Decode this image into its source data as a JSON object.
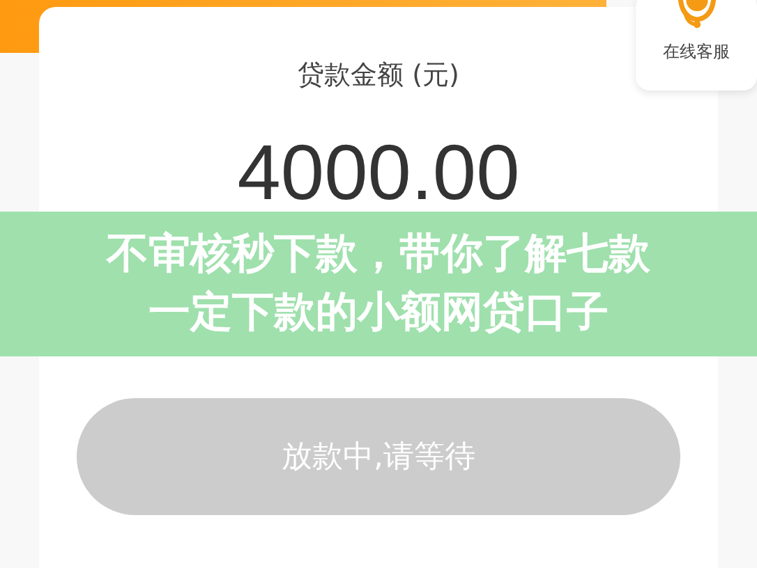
{
  "service": {
    "label": "在线客服"
  },
  "amount": {
    "label": "贷款金额 (元)",
    "value": "4000.00"
  },
  "banner": {
    "lines": [
      "不审核秒下款，带你了解七款",
      "一定下款的小额网贷口子"
    ]
  },
  "action_button": {
    "label": "放款中,请等待",
    "disabled": true
  }
}
